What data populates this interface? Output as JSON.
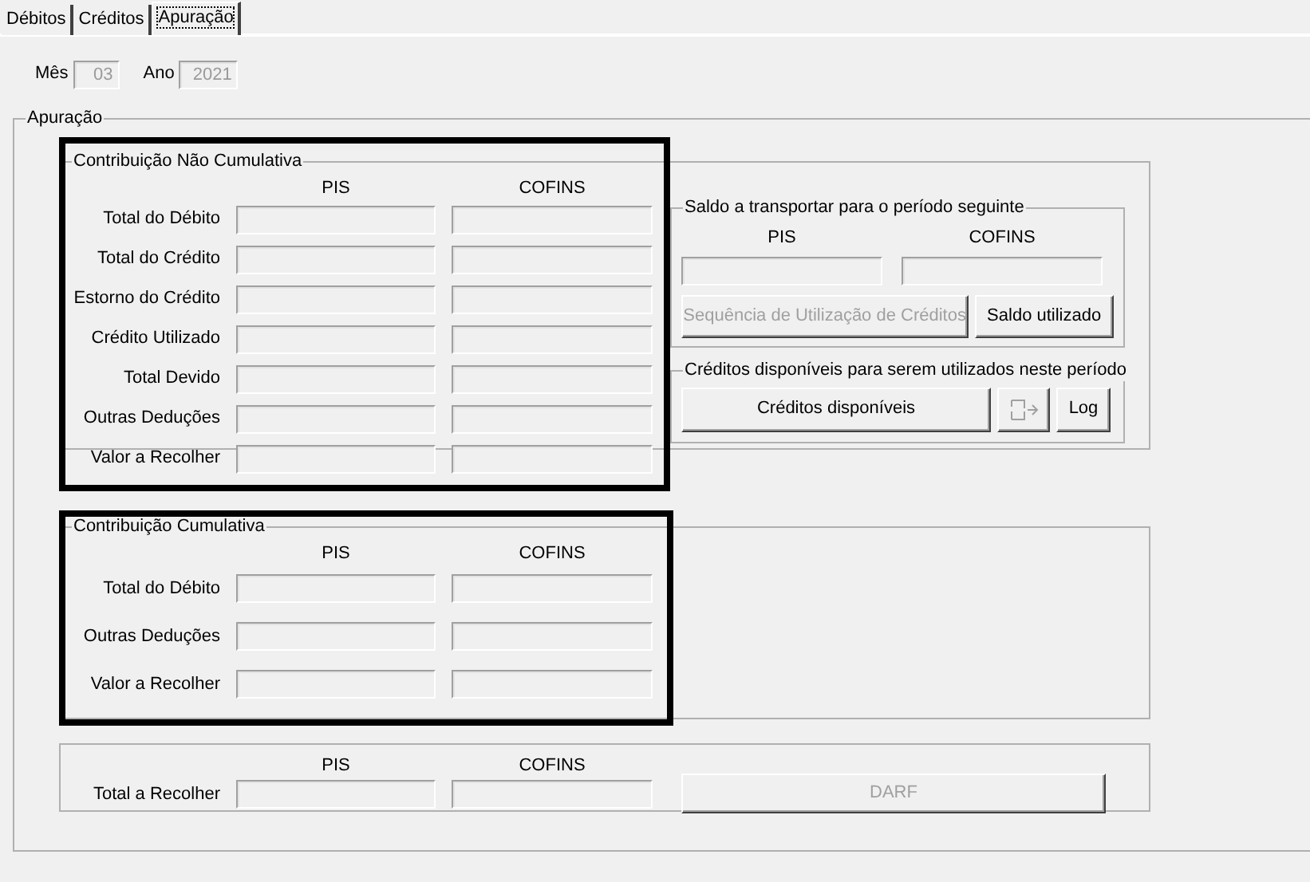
{
  "tabs": [
    {
      "label": "Débitos",
      "selected": false
    },
    {
      "label": "Créditos",
      "selected": false
    },
    {
      "label": "Apuração",
      "selected": true
    }
  ],
  "period": {
    "fields": [
      {
        "label": "Mês",
        "value": "03",
        "disabled": true
      },
      {
        "label": "Ano",
        "value": "2021",
        "disabled": true
      }
    ]
  },
  "apuracao": {
    "title": "Apuração",
    "nao_cumulativa": {
      "title": "Contribuição Não Cumulativa",
      "highlighted": true,
      "columns": [
        "PIS",
        "COFINS"
      ],
      "rows": [
        "Total do Débito",
        "Total do Crédito",
        "Estorno do Crédito",
        "Crédito Utilizado",
        "Total Devido",
        "Outras Deduções",
        "Valor a Recolher"
      ]
    },
    "saldo": {
      "title": "Saldo a transportar para o período seguinte",
      "columns": [
        "PIS",
        "COFINS"
      ],
      "buttons": [
        {
          "label": "Sequência de Utilização de Créditos",
          "disabled": true
        },
        {
          "label": "Saldo utilizado",
          "disabled": false
        }
      ]
    },
    "creditos": {
      "title": "Créditos disponíveis para serem utilizados neste período",
      "buttons": [
        {
          "kind": "text",
          "label": "Créditos disponíveis",
          "disabled": false
        },
        {
          "kind": "icon",
          "disabled": true
        },
        {
          "kind": "text",
          "label": "Log",
          "disabled": false
        }
      ]
    },
    "cumulativa": {
      "title": "Contribuição Cumulativa",
      "highlighted": true,
      "columns": [
        "PIS",
        "COFINS"
      ],
      "rows": [
        "Total do Débito",
        "Outras Deduções",
        "Valor a Recolher"
      ]
    },
    "total": {
      "highlighted": false,
      "columns": [
        "PIS",
        "COFINS"
      ],
      "label": "Total a Recolher",
      "button": {
        "label": "DARF",
        "disabled": true
      }
    }
  }
}
